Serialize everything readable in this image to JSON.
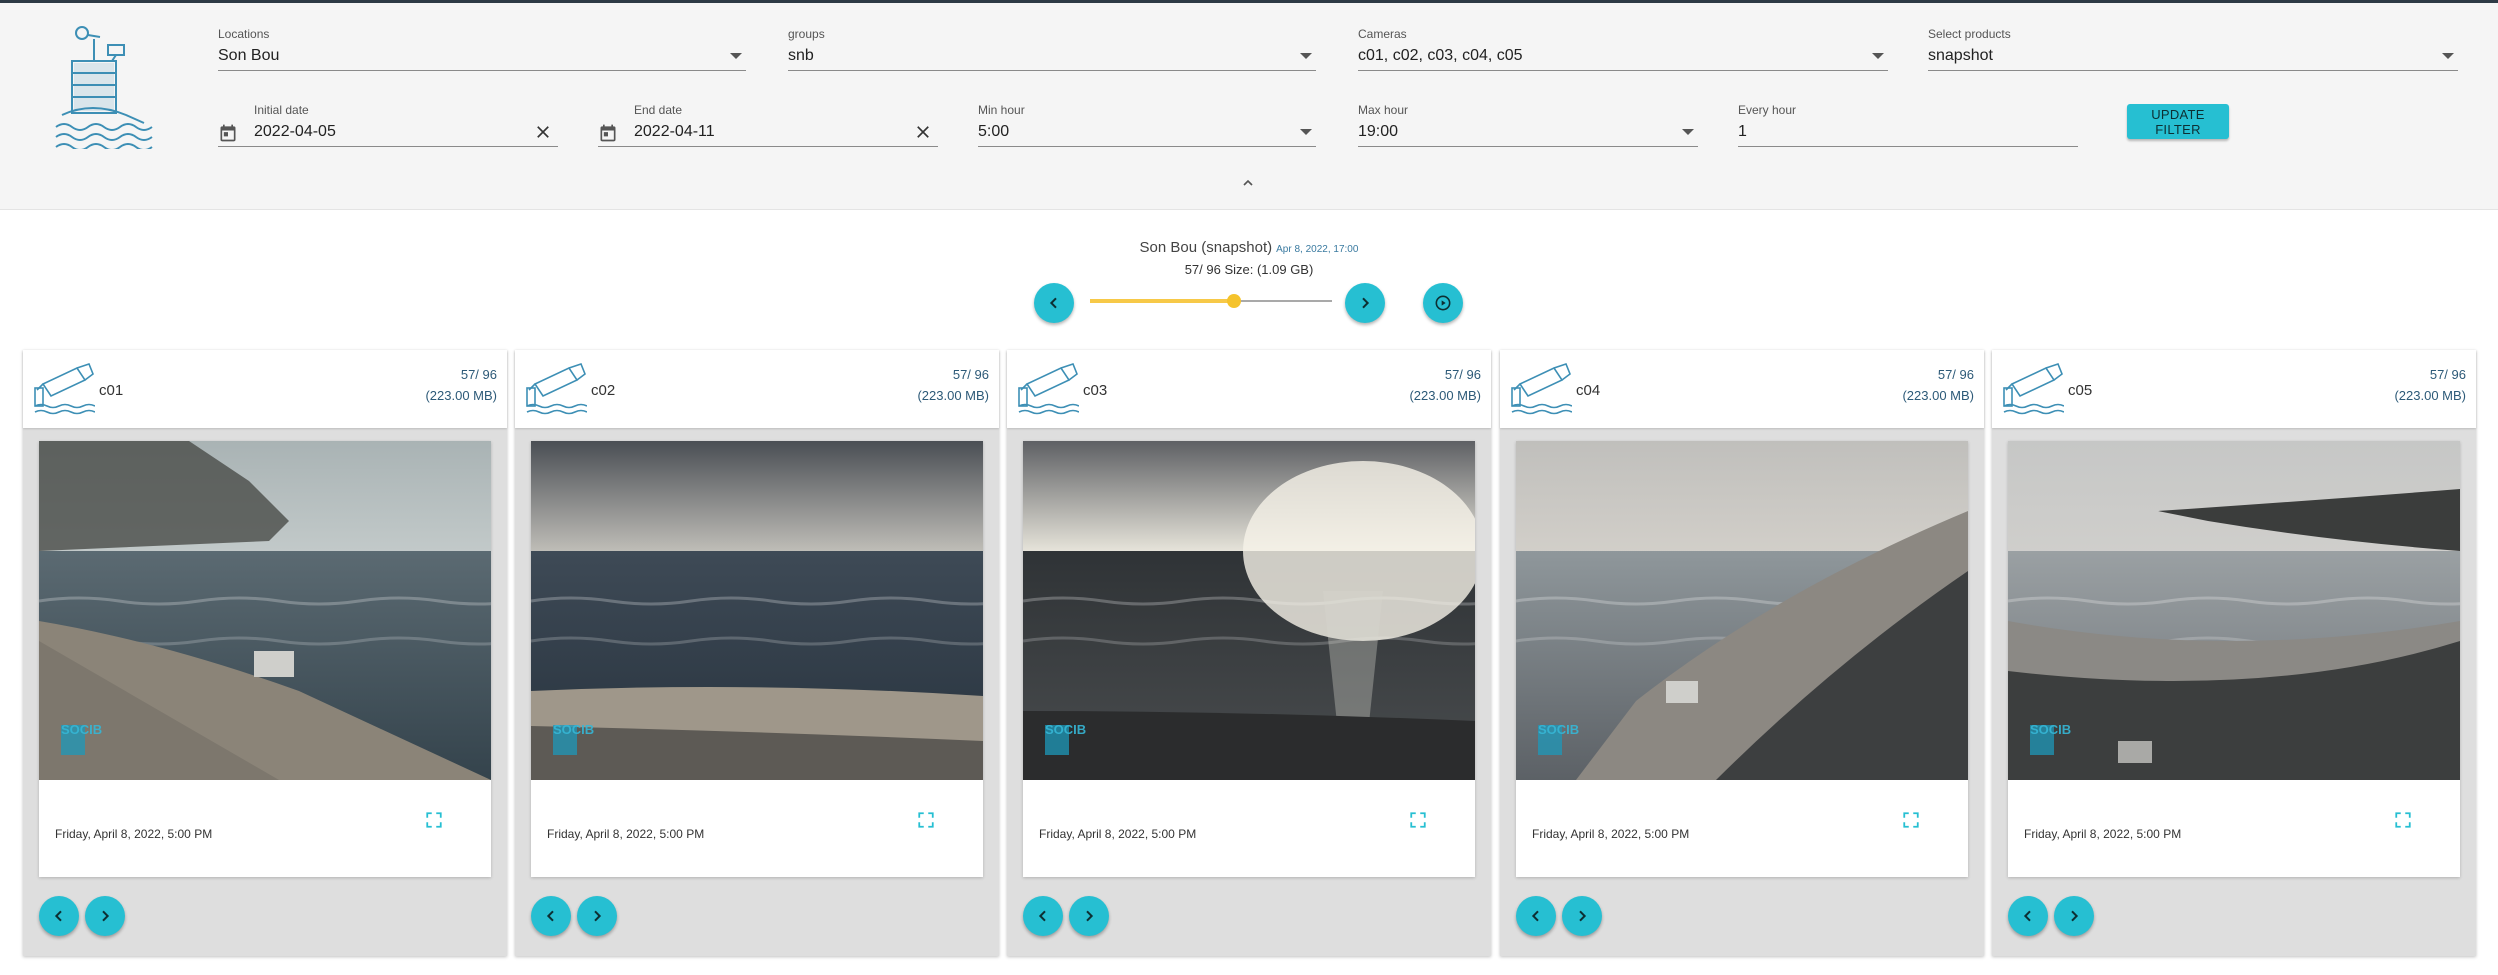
{
  "filters": {
    "locations": {
      "label": "Locations",
      "value": "Son Bou"
    },
    "groups": {
      "label": "groups",
      "value": "snb"
    },
    "cameras": {
      "label": "Cameras",
      "value": "c01, c02, c03, c04, c05"
    },
    "products": {
      "label": "Select products",
      "value": "snapshot"
    },
    "initial_date": {
      "label": "Initial date",
      "value": "2022-04-05"
    },
    "end_date": {
      "label": "End date",
      "value": "2022-04-11"
    },
    "min_hour": {
      "label": "Min hour",
      "value": "5:00"
    },
    "max_hour": {
      "label": "Max hour",
      "value": "19:00"
    },
    "every_hour": {
      "label": "Every hour",
      "value": "1"
    },
    "update_label": "UPDATE FILTER"
  },
  "player": {
    "title": "Son Bou (snapshot)",
    "timestamp": "Apr 8, 2022, 17:00",
    "info": "57/ 96 Size: (1.09 GB)",
    "position": 57,
    "total": 96
  },
  "cameras": [
    {
      "name": "c01",
      "count": "57/ 96",
      "size": "(223.00 MB)",
      "date": "Friday, April 8, 2022, 5:00 PM"
    },
    {
      "name": "c02",
      "count": "57/ 96",
      "size": "(223.00 MB)",
      "date": "Friday, April 8, 2022, 5:00 PM"
    },
    {
      "name": "c03",
      "count": "57/ 96",
      "size": "(223.00 MB)",
      "date": "Friday, April 8, 2022, 5:00 PM"
    },
    {
      "name": "c04",
      "count": "57/ 96",
      "size": "(223.00 MB)",
      "date": "Friday, April 8, 2022, 5:00 PM"
    },
    {
      "name": "c05",
      "count": "57/ 96",
      "size": "(223.00 MB)",
      "date": "Friday, April 8, 2022, 5:00 PM"
    }
  ],
  "watermark": "SOCIB",
  "colors": {
    "accent": "#26bfd2",
    "slider": "#f5c32c",
    "panel": "#f5f5f5",
    "card": "#dedede"
  },
  "icons": [
    "beach-station-logo-icon",
    "calendar-icon",
    "clear-icon",
    "dropdown-arrow-icon",
    "chevron-up-icon",
    "chevron-left-icon",
    "chevron-right-icon",
    "play-circle-icon",
    "camera-icon",
    "fullscreen-icon"
  ]
}
